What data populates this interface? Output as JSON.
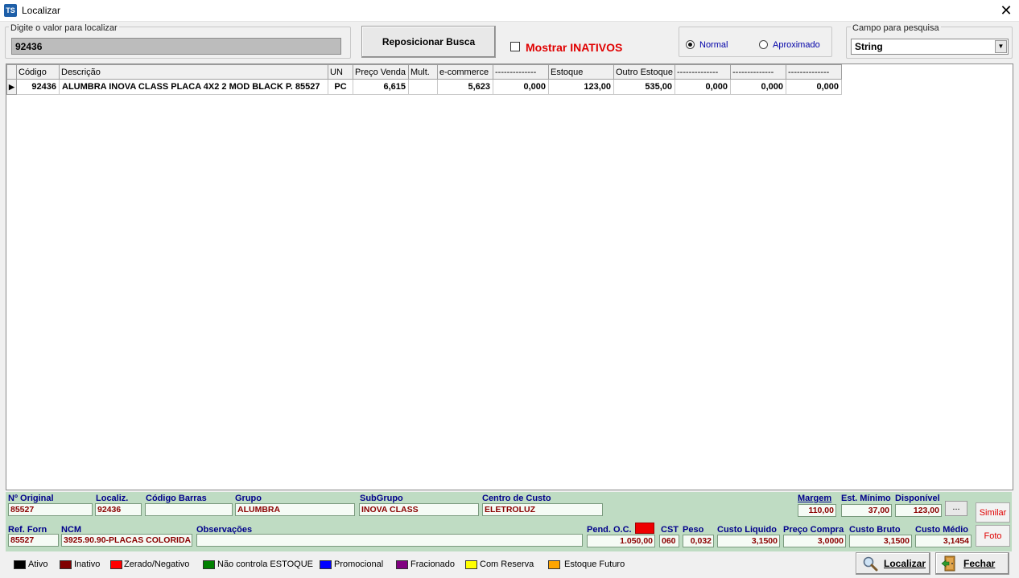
{
  "window": {
    "title": "Localizar",
    "app_icon_text": "TS",
    "close_glyph": "✕"
  },
  "search": {
    "caption": "Digite o valor para localizar",
    "value": "92436"
  },
  "reposition_button": "Reposicionar Busca",
  "show_inactive": {
    "label": "Mostrar INATIVOS",
    "checked": false
  },
  "search_mode": {
    "normal": "Normal",
    "approximate": "Aproximado",
    "selected": "Normal"
  },
  "search_field": {
    "caption": "Campo para pesquisa",
    "value": "String"
  },
  "grid": {
    "columns": [
      "Código",
      "Descrição",
      "UN",
      "Preço Venda",
      "Mult.",
      "e-commerce",
      "--------------",
      "Estoque",
      "Outro Estoque",
      "--------------",
      "--------------",
      "--------------"
    ],
    "rows": [
      [
        "92436",
        "ALUMBRA INOVA CLASS PLACA 4X2 2 MOD BLACK P. 85527",
        "PC",
        "6,615",
        "",
        "5,623",
        "0,000",
        "123,00",
        "535,00",
        "0,000",
        "0,000",
        "0,000"
      ]
    ]
  },
  "info": {
    "n_original": {
      "label": "Nº Original",
      "value": "85527"
    },
    "localiz": {
      "label": "Localiz.",
      "value": "92436"
    },
    "codigo_barras": {
      "label": "Código Barras",
      "value": ""
    },
    "grupo": {
      "label": "Grupo",
      "value": "ALUMBRA"
    },
    "subgrupo": {
      "label": "SubGrupo",
      "value": "INOVA CLASS"
    },
    "centro_custo": {
      "label": "Centro de Custo",
      "value": "ELETROLUZ"
    },
    "margem": {
      "label": "Margem",
      "value": "110,00"
    },
    "est_minimo": {
      "label": "Est. Mínimo",
      "value": "37,00"
    },
    "disponivel": {
      "label": "Disponível",
      "value": "123,00"
    },
    "more_button": "...",
    "ref_forn": {
      "label": "Ref. Forn",
      "value": "85527"
    },
    "ncm": {
      "label": "NCM",
      "value": "3925.90.90-PLACAS COLORIDA"
    },
    "observacoes": {
      "label": "Observações",
      "value": ""
    },
    "pend_oc": {
      "label": "Pend. O.C.",
      "value": "1.050,00"
    },
    "cst": {
      "label": "CST",
      "value": "060"
    },
    "peso": {
      "label": "Peso",
      "value": "0,032"
    },
    "custo_liquido": {
      "label": "Custo Liquido",
      "value": "3,1500"
    },
    "preco_compra": {
      "label": "Preço Compra",
      "value": "3,0000"
    },
    "custo_bruto": {
      "label": "Custo Bruto",
      "value": "3,1500"
    },
    "custo_medio": {
      "label": "Custo Médio",
      "value": "3,1454"
    },
    "similar_button": "Similar",
    "foto_button": "Foto"
  },
  "legend": [
    {
      "label": "Ativo",
      "color": "#000000"
    },
    {
      "label": "Inativo",
      "color": "#800000"
    },
    {
      "label": "Zerado/Negativo",
      "color": "#ff0000"
    },
    {
      "label": "Não controla ESTOQUE",
      "color": "#008000"
    },
    {
      "label": "Promocional",
      "color": "#0000ff"
    },
    {
      "label": "Fracionado",
      "color": "#800080"
    },
    {
      "label": "Com Reserva",
      "color": "#ffff00"
    },
    {
      "label": "Estoque Futuro",
      "color": "#ffa500"
    }
  ],
  "footer": {
    "localizar": "Localizar",
    "fechar": "Fechar"
  }
}
